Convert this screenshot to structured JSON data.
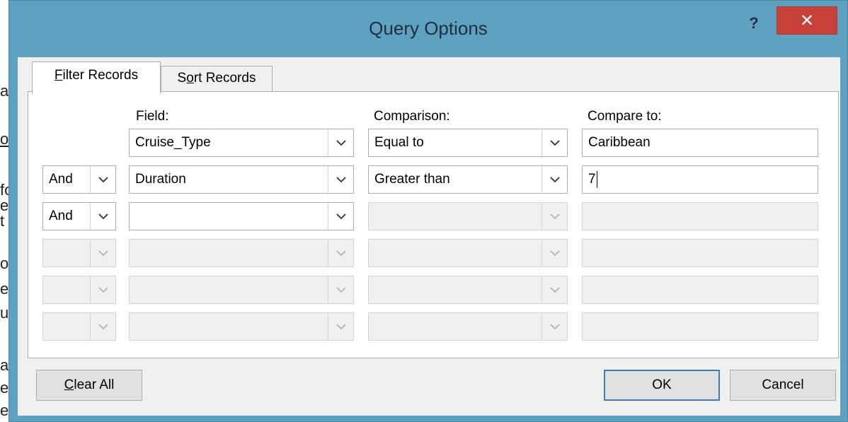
{
  "dialog": {
    "title": "Query Options",
    "help_label": "?",
    "close_label": "✕"
  },
  "tabs": [
    {
      "label_pre": "",
      "label_u": "F",
      "label_post": "ilter Records"
    },
    {
      "label_pre": "S",
      "label_u": "o",
      "label_post": "rt Records"
    }
  ],
  "columns": {
    "field": "Field:",
    "comparison": "Comparison:",
    "compare_to": "Compare to:"
  },
  "rows": [
    {
      "conj": "",
      "field": "Cruise_Type",
      "comparison": "Equal to",
      "compare_to": "Caribbean"
    },
    {
      "conj": "And",
      "field": "Duration",
      "comparison": "Greater than",
      "compare_to": "7"
    },
    {
      "conj": "And",
      "field": "",
      "comparison": "",
      "compare_to": ""
    },
    {
      "conj": "",
      "field": "",
      "comparison": "",
      "compare_to": ""
    },
    {
      "conj": "",
      "field": "",
      "comparison": "",
      "compare_to": ""
    },
    {
      "conj": "",
      "field": "",
      "comparison": "",
      "compare_to": ""
    }
  ],
  "buttons": {
    "clear_u": "C",
    "clear_rest": "lear All",
    "ok": "OK",
    "cancel": "Cancel"
  },
  "background_fragments": [
    "ac",
    "ok",
    "fo",
    "ef",
    "t",
    "o",
    "ee",
    "ur",
    "a",
    "ec",
    "e"
  ],
  "colors": {
    "titlebar": "#5fa1c0",
    "close": "#c7413a",
    "ok_border": "#3c7fb1"
  }
}
